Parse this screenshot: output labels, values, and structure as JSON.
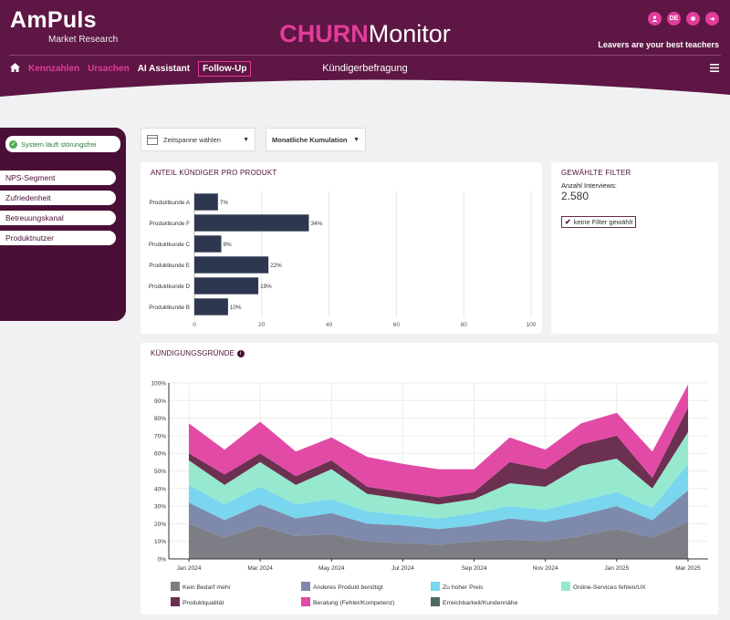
{
  "header": {
    "brand": "AmPuls",
    "brand_sub": "Market Research",
    "title_part1": "CHURN",
    "title_part2": "Monitor",
    "tagline": "Leavers are your best teachers",
    "page_subtitle": "Kündigerbefragung",
    "top_icons": [
      "user-icon",
      "language-icon",
      "settings-icon",
      "logout-icon"
    ],
    "language_label": "DE"
  },
  "nav": {
    "items": [
      "Kennzahlen",
      "Ursachen",
      "AI Assistant",
      "Follow-Up"
    ]
  },
  "sidebar": {
    "status": "System läuft störungsfrei",
    "items": [
      "NPS-Segment",
      "Zufriedenheit",
      "Betreuungskanal",
      "Produktnutzer"
    ]
  },
  "controls": {
    "date_placeholder": "Zeitspanne wählen",
    "aggregation": "Monatliche Kumulation"
  },
  "filter_card": {
    "title": "GEWÄHLTE FILTER",
    "label": "Anzahl Interviews:",
    "value": "2.580",
    "checkbox": "keine Filter gewählt"
  },
  "bar_card": {
    "title": "ANTEIL KÜNDIGER PRO PRODUKT"
  },
  "area_card": {
    "title": "KÜNDIGUNGSGRÜNDE"
  },
  "colors": {
    "brand": "#5e1644",
    "accent": "#e23c9b",
    "bar": "#2d3850"
  },
  "chart_data": [
    {
      "type": "bar",
      "orientation": "horizontal",
      "categories": [
        "Produktkunde A",
        "Produktkunde F",
        "Produktkunde C",
        "Produktkunde E",
        "Produktkunde D",
        "Produktkunde B"
      ],
      "values": [
        7,
        34,
        8,
        22,
        19,
        10
      ],
      "value_labels": [
        "7%",
        "34%",
        "8%",
        "22%",
        "19%",
        "10%"
      ],
      "xlim": [
        0,
        100
      ],
      "xticks": [
        0,
        20,
        40,
        60,
        80,
        100
      ]
    },
    {
      "type": "area",
      "stacked": true,
      "x": [
        "Jan 2024",
        "Feb 2024",
        "Mar 2024",
        "Apr 2024",
        "May 2024",
        "Jun 2024",
        "Jul 2024",
        "Aug 2024",
        "Sep 2024",
        "Oct 2024",
        "Nov 2024",
        "Dec 2024",
        "Jan 2025",
        "Feb 2025",
        "Mar 2025"
      ],
      "xticks": [
        "Jan 2024",
        "Mar 2024",
        "May 2024",
        "Jul 2024",
        "Sep 2024",
        "Nov 2024",
        "Jan 2025",
        "Mar 2025"
      ],
      "ylim": [
        0,
        100
      ],
      "yticks": [
        "0%",
        "10%",
        "20%",
        "30%",
        "40%",
        "50%",
        "60%",
        "70%",
        "80%",
        "90%",
        "100%"
      ],
      "legend_position": "bottom",
      "series": [
        {
          "name": "Kein Bedarf mehr",
          "color": "#7d7d85",
          "values": [
            20,
            12,
            19,
            13,
            14,
            10,
            9,
            8,
            10,
            11,
            10,
            13,
            17,
            12,
            21
          ]
        },
        {
          "name": "Anderes Produkt benötigt",
          "color": "#7e8aab",
          "values": [
            12,
            10,
            12,
            10,
            12,
            10,
            10,
            9,
            9,
            12,
            11,
            12,
            13,
            10,
            18
          ]
        },
        {
          "name": "Zu hoher Preis",
          "color": "#79d6ee",
          "values": [
            10,
            9,
            10,
            8,
            8,
            7,
            6,
            6,
            7,
            7,
            7,
            8,
            8,
            7,
            15
          ]
        },
        {
          "name": "Online-Services fehlen/UX",
          "color": "#96e9cf",
          "values": [
            14,
            11,
            14,
            11,
            17,
            10,
            9,
            8,
            8,
            13,
            13,
            20,
            19,
            11,
            18
          ]
        },
        {
          "name": "Produktqualität",
          "color": "#6c3050",
          "values": [
            4,
            6,
            5,
            5,
            5,
            4,
            4,
            4,
            4,
            12,
            10,
            12,
            13,
            6,
            14
          ]
        },
        {
          "name": "Beratung (Fehler/Kompetenz)",
          "color": "#e14ba6",
          "values": [
            17,
            14,
            18,
            14,
            13,
            17,
            16,
            16,
            13,
            14,
            11,
            12,
            13,
            15,
            13
          ]
        },
        {
          "name": "Erreichbarkeit/Kundennähe",
          "color": "#4f6a5e",
          "values": [
            0,
            0,
            0,
            0,
            0,
            0,
            0,
            0,
            0,
            0,
            0,
            0,
            0,
            0,
            0
          ]
        }
      ]
    }
  ]
}
